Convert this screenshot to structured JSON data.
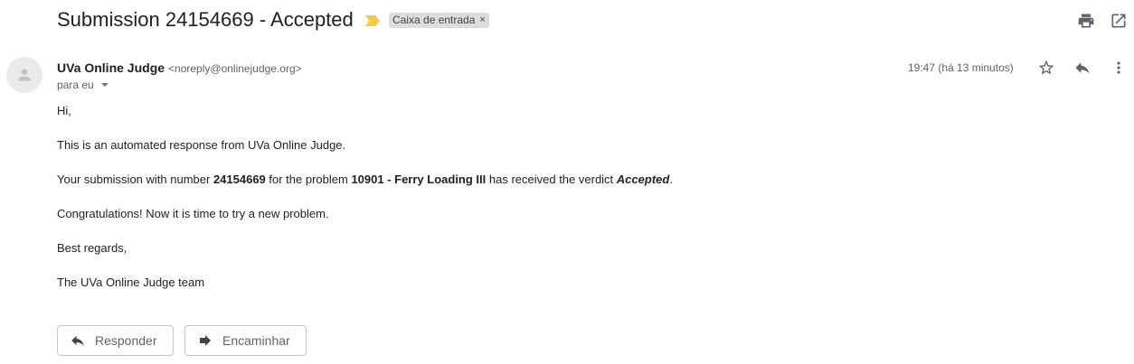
{
  "thread": {
    "subject": "Submission 24154669 - Accepted",
    "label": "Caixa de entrada",
    "label_remove": "×"
  },
  "toolbar": {
    "print_icon": "print-icon",
    "popout_icon": "open-in-new-window-icon"
  },
  "message": {
    "sender_name": "UVa Online Judge",
    "sender_email": "<noreply@onlinejudge.org>",
    "recipient": "para eu",
    "timestamp": "19:47 (há 13 minutos)",
    "actions": {
      "star_icon": "star-icon",
      "reply_icon": "reply-icon",
      "more_icon": "more-vertical-icon"
    }
  },
  "body": {
    "greeting": "Hi,",
    "intro": "This is an automated response from UVa Online Judge.",
    "verdict_prefix": "Your submission with number ",
    "submission_number": "24154669",
    "verdict_middle": " for the problem ",
    "problem": "10901 - Ferry Loading III",
    "verdict_suffix": " has received the verdict ",
    "verdict": "Accepted",
    "verdict_end": ".",
    "congrats": "Congratulations! Now it is time to try a new problem.",
    "regards": "Best regards,",
    "signature": "The UVa Online Judge team"
  },
  "footer": {
    "reply_label": "Responder",
    "forward_label": "Encaminhar"
  },
  "colors": {
    "important_marker": "#f2c94c",
    "label_chip_bg": "#dddddd",
    "icon": "#5f6368"
  }
}
